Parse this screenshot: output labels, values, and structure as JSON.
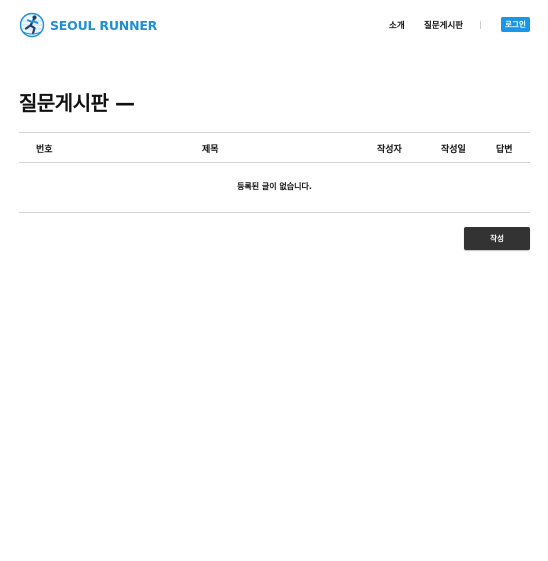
{
  "header": {
    "logo_text": "SEOUL RUNNER",
    "logo_icon": "runner-icon",
    "nav": {
      "about": "소개",
      "board": "질문게시판"
    },
    "login_label": "로그인"
  },
  "page": {
    "title": "질문게시판 —"
  },
  "table": {
    "columns": {
      "no": "번호",
      "title": "제목",
      "writer": "작성자",
      "date": "작성일",
      "answer": "답변"
    },
    "empty_message": "등록된 글이 없습니다."
  },
  "actions": {
    "write_label": "작성"
  },
  "colors": {
    "brand": "#1f8fd6",
    "login_button": "#1a96e6",
    "write_button": "#333333",
    "divider": "#d4d4d4"
  }
}
